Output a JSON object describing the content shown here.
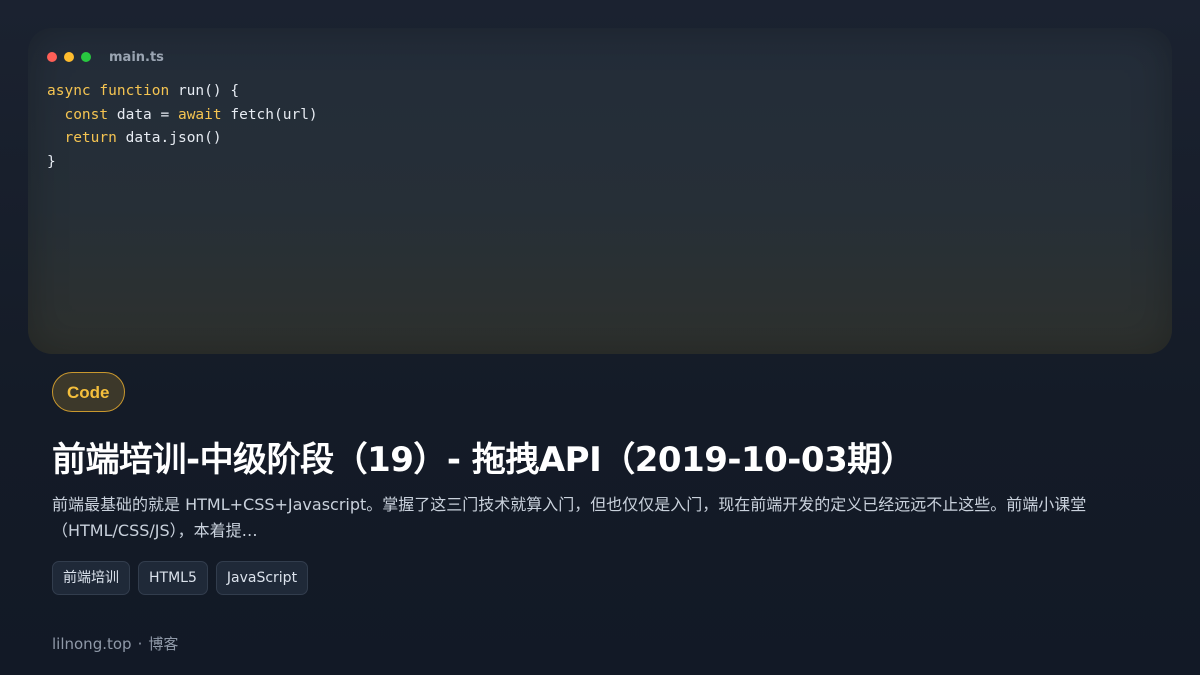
{
  "code_card": {
    "filename": "main.ts",
    "lines": [
      {
        "kw": "async function",
        "rest": " run() {"
      },
      {
        "indent": "  ",
        "kw": "const",
        "rest": " data = ",
        "kw2": "await",
        "rest2": " fetch(url)"
      },
      {
        "indent": "  ",
        "kw": "return",
        "rest": " data.json()"
      },
      {
        "rest": "}"
      }
    ],
    "keyword_color": "#f5c451"
  },
  "badge": {
    "label": "Code",
    "color": "#f5bf3c"
  },
  "article": {
    "title": "前端培训-中级阶段（19）- 拖拽API（2019-10-03期）",
    "description": "前端最基础的就是 HTML+CSS+Javascript。掌握了这三门技术就算入门，但也仅仅是入门，现在前端开发的定义已经远远不止这些。前端小课堂（HTML/CSS/JS），本着提…",
    "tags": [
      "前端培训",
      "HTML5",
      "JavaScript"
    ]
  },
  "footer": {
    "site": "lilnong.top",
    "separator": "·",
    "section": "博客"
  }
}
